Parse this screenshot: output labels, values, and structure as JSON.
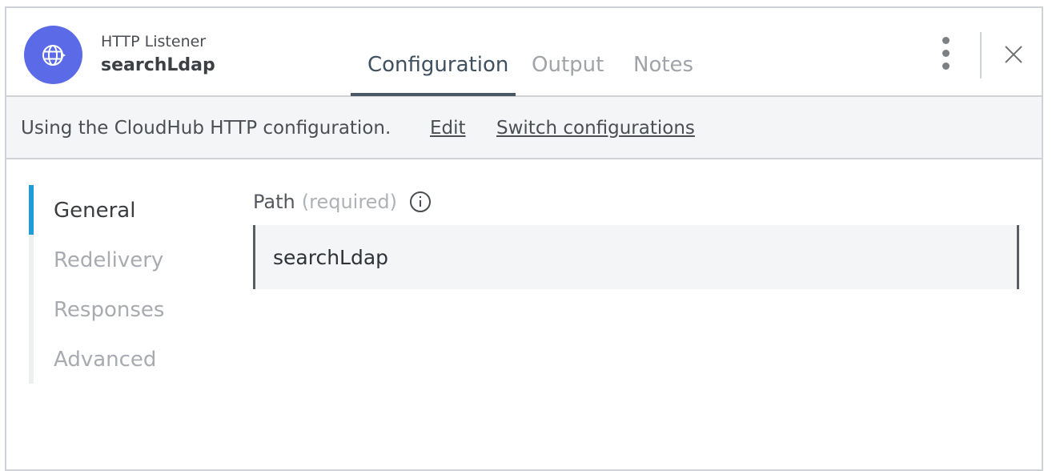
{
  "header": {
    "component_type": "HTTP Listener",
    "component_name": "searchLdap",
    "avatar_icon": "globe-icon",
    "avatar_color": "#5b6ae6",
    "tabs": [
      {
        "label": "Configuration",
        "active": true
      },
      {
        "label": "Output",
        "active": false
      },
      {
        "label": "Notes",
        "active": false
      }
    ],
    "more_icon": "kebab-menu-icon",
    "close_icon": "close-icon"
  },
  "config_bar": {
    "text": "Using the CloudHub HTTP configuration.",
    "edit_label": "Edit",
    "switch_label": "Switch configurations"
  },
  "sidenav": {
    "accent_color": "#1f9dd9",
    "items": [
      {
        "label": "General",
        "active": true
      },
      {
        "label": "Redelivery",
        "active": false
      },
      {
        "label": "Responses",
        "active": false
      },
      {
        "label": "Advanced",
        "active": false
      }
    ]
  },
  "form": {
    "path_label": "Path",
    "path_required": "(required)",
    "path_value": "searchLdap"
  }
}
